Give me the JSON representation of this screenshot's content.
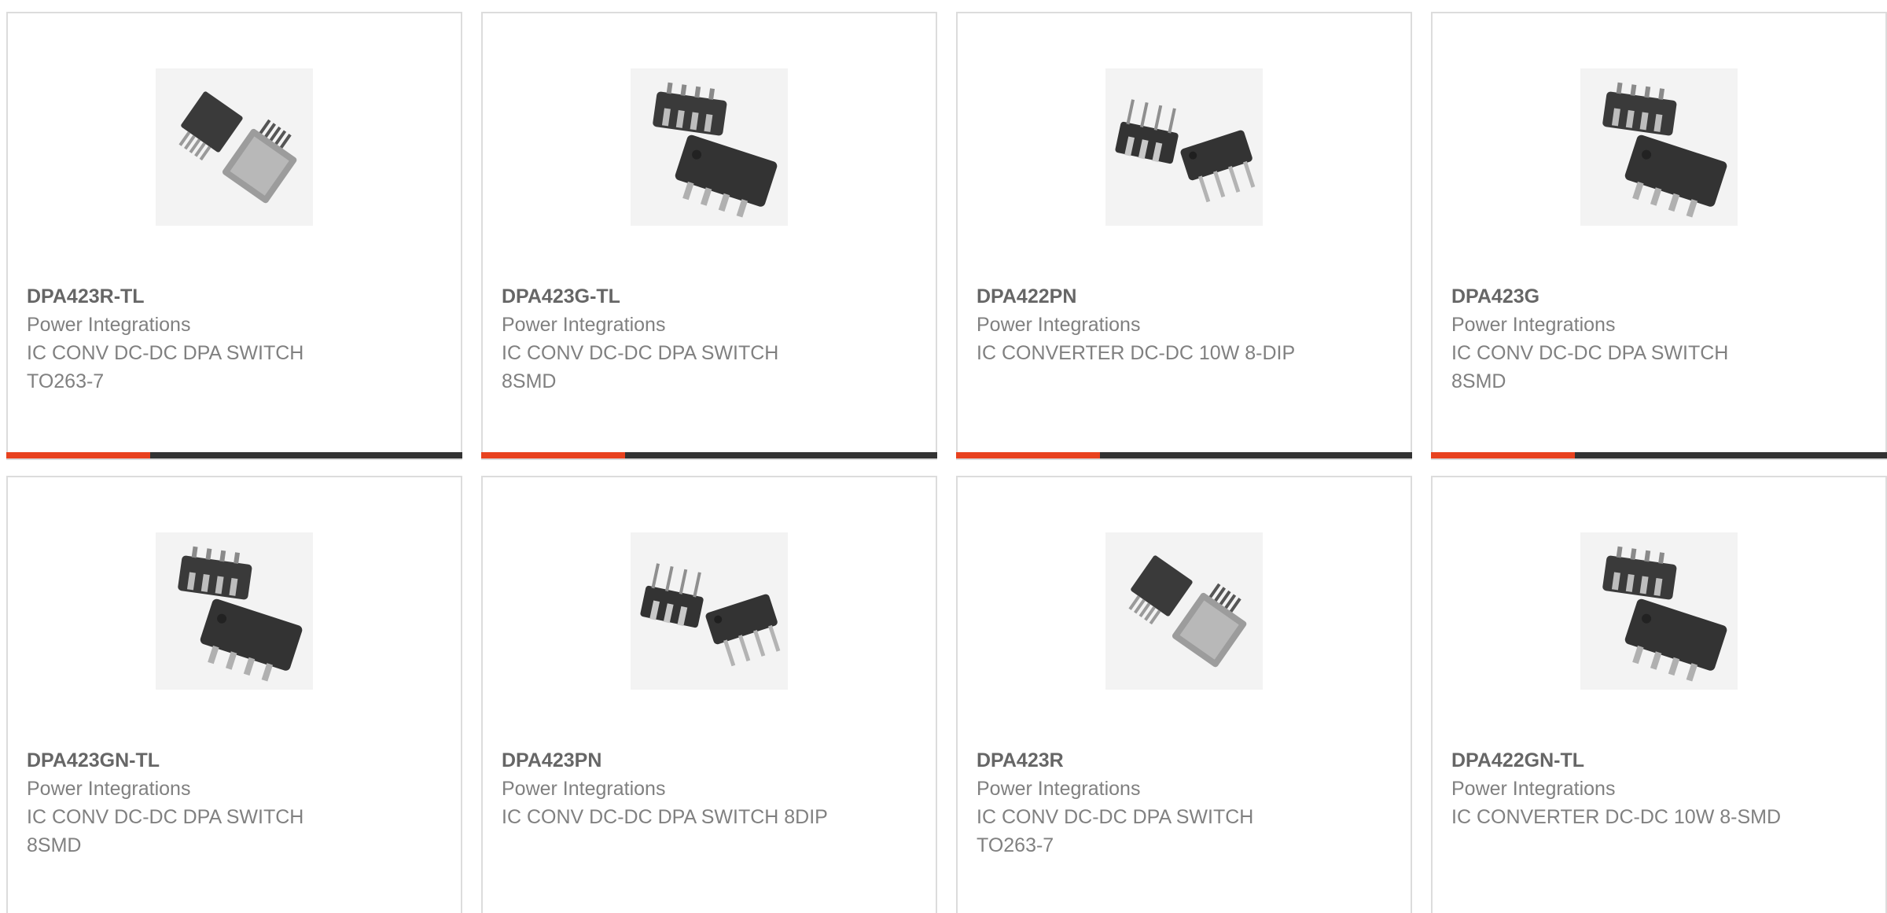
{
  "colors": {
    "accent": "#e8421f",
    "bar_dark": "#333333",
    "border": "#dcdcdc",
    "text_title": "#666666",
    "text_body": "#808080"
  },
  "products": [
    {
      "part_number": "DPA423R-TL",
      "manufacturer": "Power Integrations",
      "description": "IC CONV DC-DC DPA SWITCH TO263-7",
      "package_icon": "to263-package-icon"
    },
    {
      "part_number": "DPA423G-TL",
      "manufacturer": "Power Integrations",
      "description": "IC CONV DC-DC DPA SWITCH 8SMD",
      "package_icon": "smd8-package-icon"
    },
    {
      "part_number": "DPA422PN",
      "manufacturer": "Power Integrations",
      "description": "IC CONVERTER DC-DC 10W 8-DIP",
      "package_icon": "dip8-package-icon"
    },
    {
      "part_number": "DPA423G",
      "manufacturer": "Power Integrations",
      "description": "IC CONV DC-DC DPA SWITCH 8SMD",
      "package_icon": "smd8-package-icon"
    },
    {
      "part_number": "DPA423GN-TL",
      "manufacturer": "Power Integrations",
      "description": "IC CONV DC-DC DPA SWITCH 8SMD",
      "package_icon": "smd8-package-icon"
    },
    {
      "part_number": "DPA423PN",
      "manufacturer": "Power Integrations",
      "description": "IC CONV DC-DC DPA SWITCH 8DIP",
      "package_icon": "dip8-package-icon"
    },
    {
      "part_number": "DPA423R",
      "manufacturer": "Power Integrations",
      "description": "IC CONV DC-DC DPA SWITCH TO263-7",
      "package_icon": "to263-package-icon"
    },
    {
      "part_number": "DPA422GN-TL",
      "manufacturer": "Power Integrations",
      "description": "IC CONVERTER DC-DC 10W 8-SMD",
      "package_icon": "smd8-package-icon"
    }
  ]
}
